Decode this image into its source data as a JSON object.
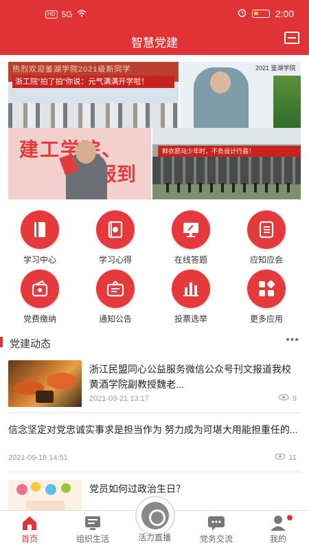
{
  "status": {
    "hd": "HD",
    "signal": "5G",
    "time": "2:00"
  },
  "header": {
    "title": "智慧党建",
    "scan_icon": "scan-icon"
  },
  "banner": {
    "top_left_line1": "热烈欢迎鉴湖学院2021级新同学",
    "top_left_line2": "浙工院“拍了拍”你说：元气满满开学啦！",
    "top_right_tag": "2021 鉴湖学院",
    "bottom_left_text": "建工学院、",
    "bottom_left_text2": "报到",
    "bottom_right_banner": "鲜衣怒马少年时，不负设计行县！"
  },
  "menu": [
    {
      "label": "学习中心",
      "icon": "book-icon"
    },
    {
      "label": "学习心得",
      "icon": "notebook-icon"
    },
    {
      "label": "在线答题",
      "icon": "monitor-pen-icon"
    },
    {
      "label": "应知应会",
      "icon": "document-list-icon"
    },
    {
      "label": "党费缴纳",
      "icon": "wallet-icon"
    },
    {
      "label": "通知公告",
      "icon": "noticeboard-icon"
    },
    {
      "label": "投票选举",
      "icon": "bar-chart-icon"
    },
    {
      "label": "更多应用",
      "icon": "apps-grid-icon"
    }
  ],
  "section": {
    "title": "党建动态",
    "more": "•••"
  },
  "news": [
    {
      "title": "浙江民盟同心公益服务微信公众号刊文报道我校黄酒学院副教授魏老...",
      "date": "2021-09-21 13:17",
      "views": "9"
    },
    {
      "title": "信念坚定对党忠诚实事求是担当作为 努力成为可堪大用能担重任的...",
      "date": "2021-09-18 14:51",
      "views": "11"
    },
    {
      "title": "党员如何过政治生日？"
    }
  ],
  "nav": [
    {
      "label": "首页",
      "icon": "home-icon"
    },
    {
      "label": "组织生活",
      "icon": "screen-icon"
    },
    {
      "label": "活力直播",
      "icon": "camera-aperture-icon"
    },
    {
      "label": "党务交流",
      "icon": "chat-icon"
    },
    {
      "label": "我的",
      "icon": "user-icon"
    }
  ],
  "colors": {
    "accent": "#e13335",
    "icon_bg": "#e5393b",
    "text": "#333333",
    "muted": "#999999"
  }
}
